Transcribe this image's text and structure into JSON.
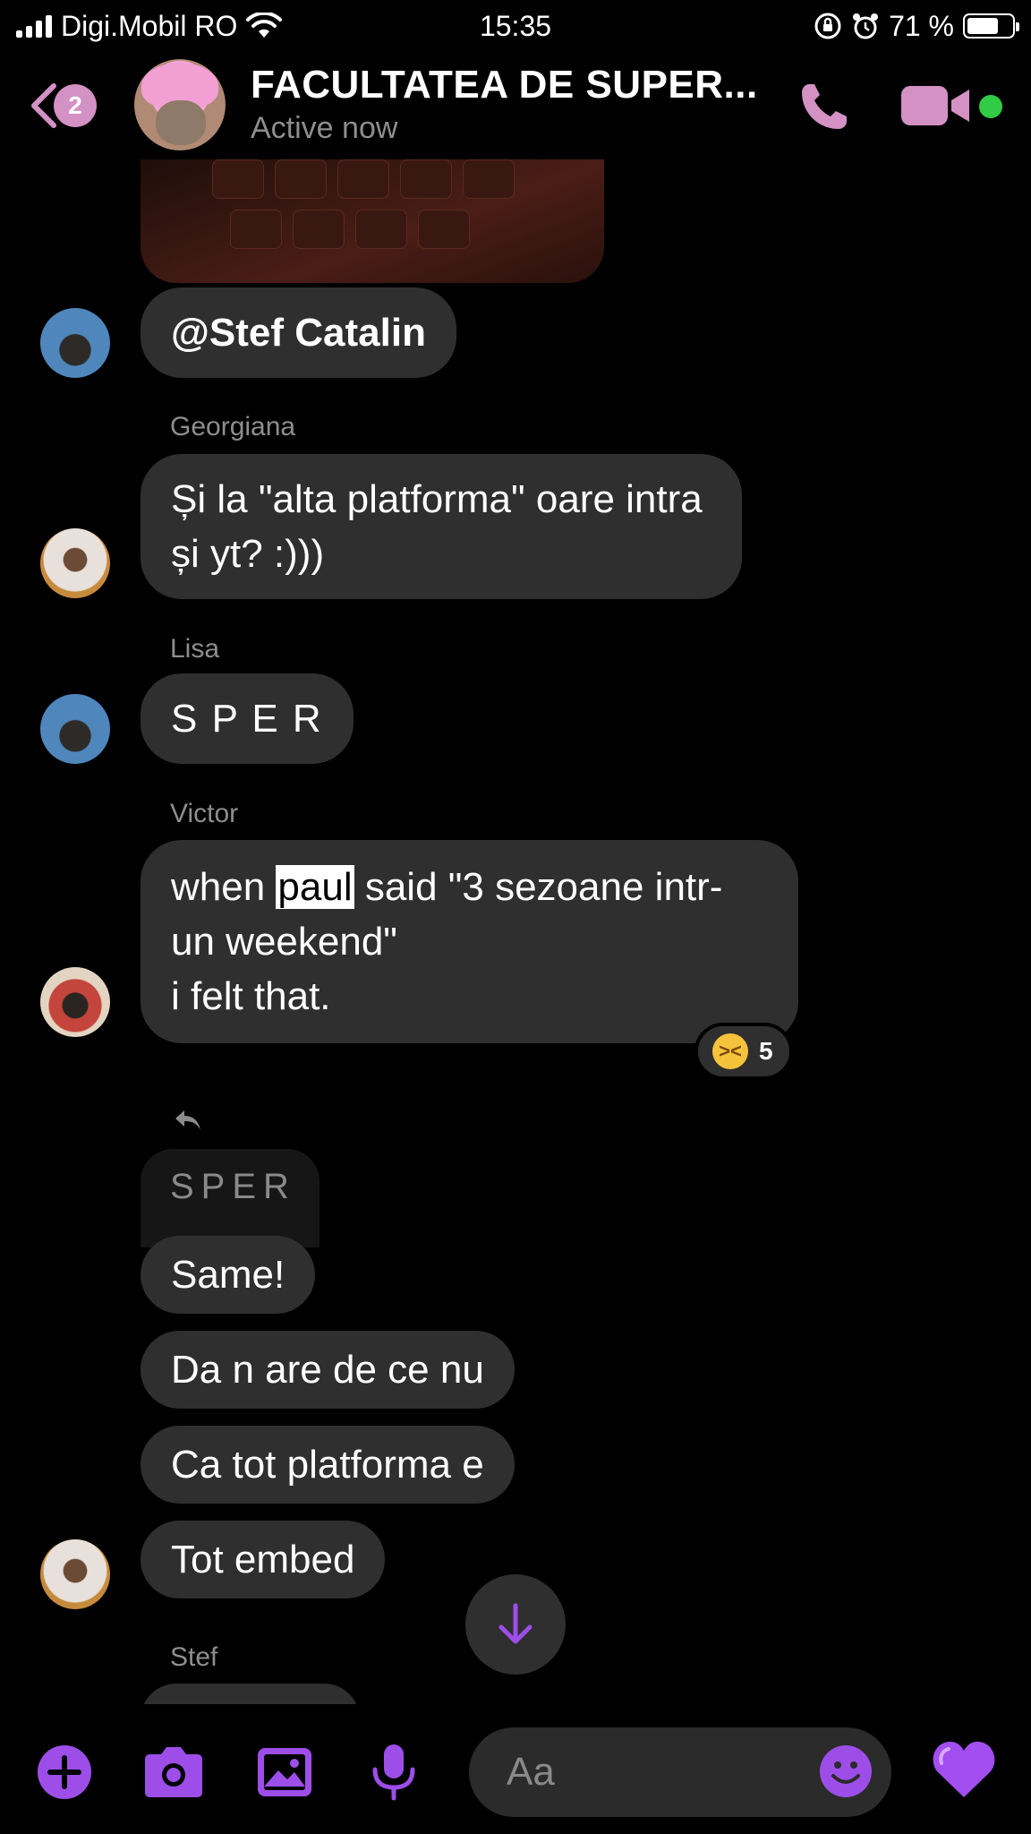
{
  "status_bar": {
    "carrier": "Digi.Mobil RO",
    "time": "15:35",
    "battery": "71 %",
    "battery_level": 0.71
  },
  "header": {
    "back_badge": "2",
    "title": "FACULTATEA DE SUPER...",
    "subtitle": "Active now",
    "online": true
  },
  "messages": [
    {
      "sender": "",
      "text": "@Stef Catalin"
    },
    {
      "sender": "Georgiana",
      "lines": [
        "Și la \"alta platforma\" oare intra",
        "și yt? :)))"
      ]
    },
    {
      "sender": "Lisa",
      "text": "S P E R"
    },
    {
      "sender": "Victor",
      "line1_before": "when ",
      "line1_highlight": "paul",
      "line1_after": " said \"3 sezoane intr-",
      "line2": "un weekend\"",
      "line3": "i felt that.",
      "reaction": {
        "emoji": "laughing",
        "count": "5"
      }
    },
    {
      "quoted_reply": "SPER"
    },
    {
      "text": "Same!"
    },
    {
      "text": "Da n are de ce nu"
    },
    {
      "text": "Ca tot platforma e"
    },
    {
      "text": "Tot embed"
    },
    {
      "sender": "Stef"
    }
  ],
  "composer": {
    "placeholder": "Aa"
  },
  "colors": {
    "accent": "#9d4ee8",
    "header_pink": "#d391c4",
    "bubble": "#2f2f2f",
    "online": "#31cc46"
  },
  "icons": [
    "back-chevron-icon",
    "phone-icon",
    "video-camera-icon",
    "plus-icon",
    "camera-icon",
    "image-icon",
    "microphone-icon",
    "smiley-icon",
    "heart-icon",
    "arrow-down-icon",
    "reply-icon",
    "wifi-icon",
    "alarm-icon",
    "rotation-lock-icon"
  ]
}
